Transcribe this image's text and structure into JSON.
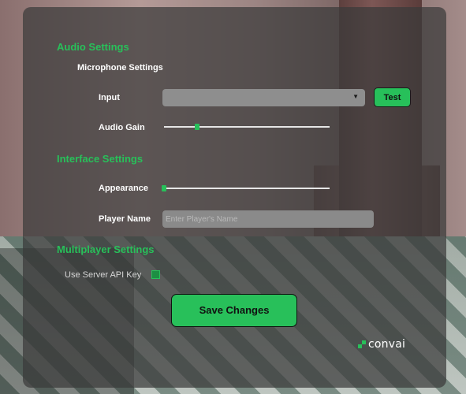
{
  "audio": {
    "title": "Audio Settings",
    "microphone_title": "Microphone Settings",
    "input_label": "Input",
    "input_value": "",
    "test_label": "Test",
    "gain_label": "Audio Gain",
    "gain_level": 0.2
  },
  "interface": {
    "title": "Interface Settings",
    "appearance_label": "Appearance",
    "appearance_level": 0.0,
    "player_name_label": "Player Name",
    "player_name_value": "",
    "player_name_placeholder": "Enter Player's Name"
  },
  "multiplayer": {
    "title": "Multiplayer Settings",
    "server_key_label": "Use Server API Key",
    "server_key_checked": false
  },
  "actions": {
    "save_label": "Save Changes"
  },
  "brand": {
    "name": "convai"
  },
  "colors": {
    "accent": "#28c05a",
    "panel": "#3a3a3a"
  },
  "icons": {
    "dropdown": "triangle-down-icon",
    "logo": "convai-logo-icon"
  }
}
